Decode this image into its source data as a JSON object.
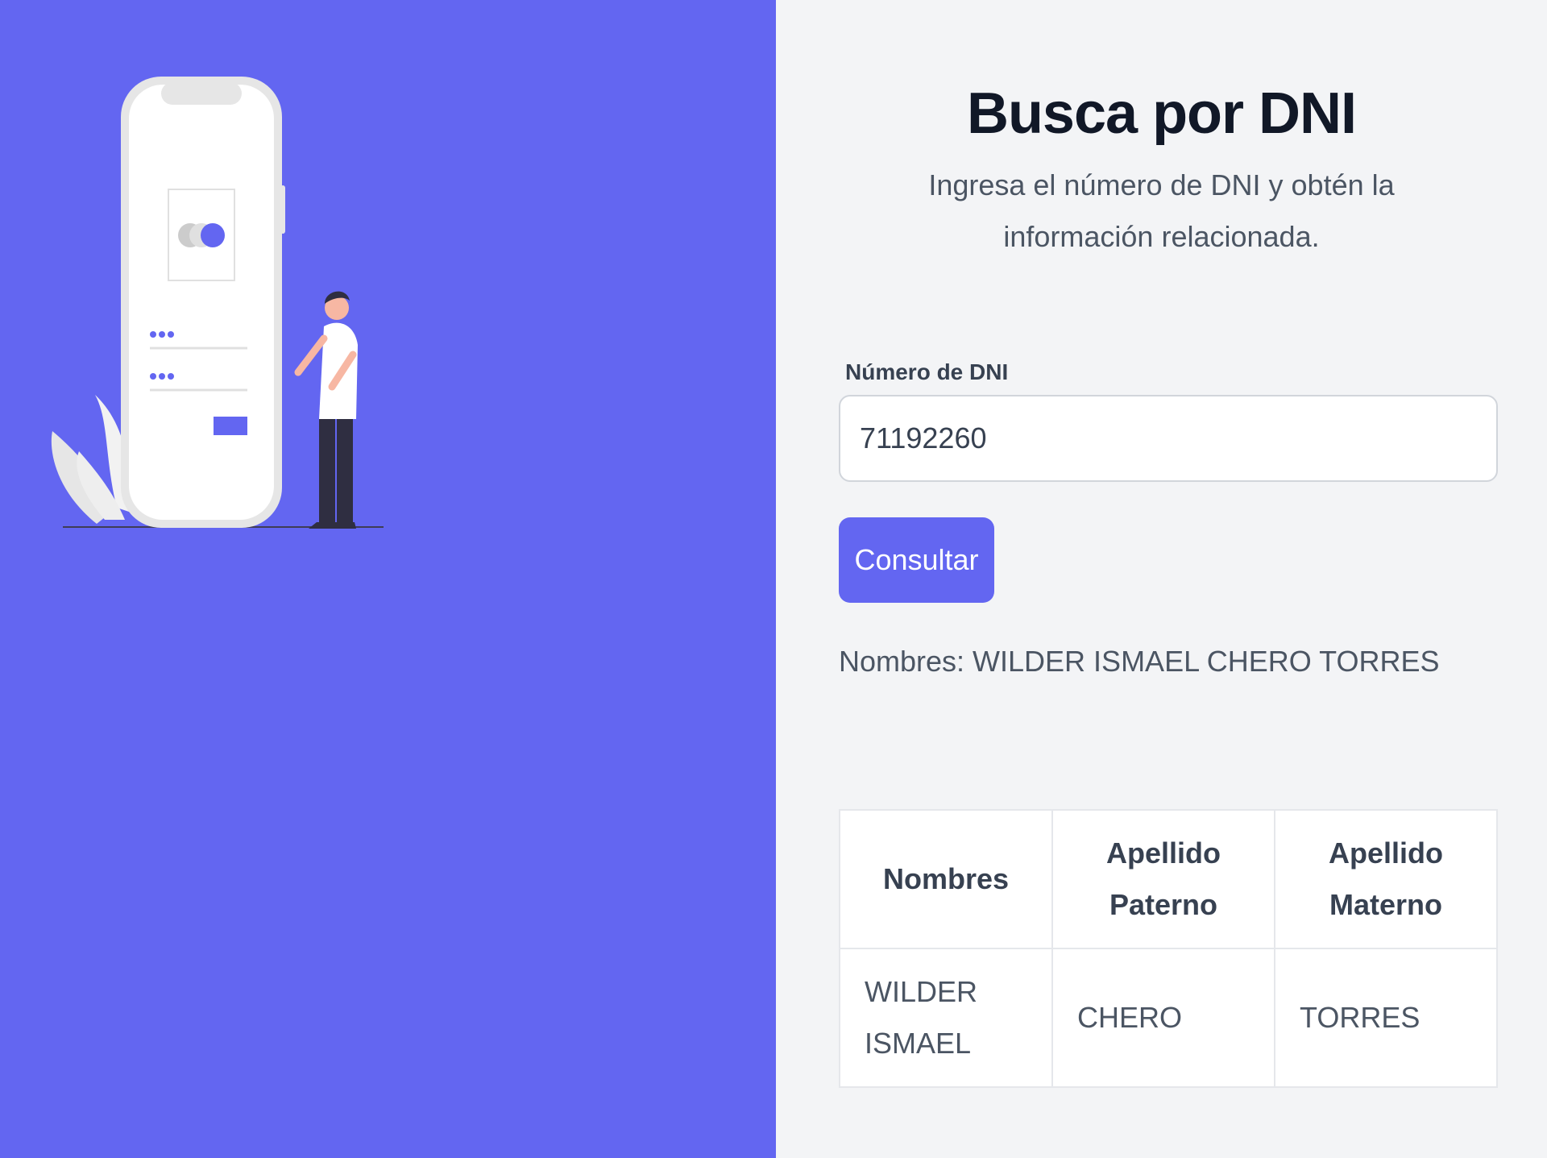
{
  "colors": {
    "accent": "#6366f1",
    "panel_background": "#f3f4f6",
    "title_text": "#111827",
    "body_text": "#4b5563"
  },
  "illustration": {
    "icon": "person-with-phone-login-illustration"
  },
  "header": {
    "title": "Busca por DNI",
    "subtitle": "Ingresa el número de DNI y obtén la información relacionada."
  },
  "form": {
    "label": "Número de DNI",
    "value": "71192260",
    "button_label": "Consultar"
  },
  "result": {
    "text": "Nombres: WILDER ISMAEL CHERO TORRES"
  },
  "table": {
    "headers": [
      "Nombres",
      "Apellido Paterno",
      "Apellido Materno"
    ],
    "rows": [
      [
        "WILDER ISMAEL",
        "CHERO",
        "TORRES"
      ]
    ]
  }
}
